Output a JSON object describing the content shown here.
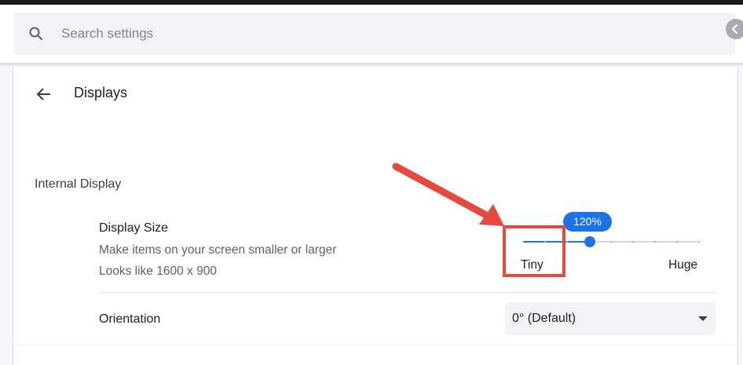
{
  "search": {
    "placeholder": "Search settings"
  },
  "page": {
    "title": "Displays"
  },
  "section": {
    "title": "Internal Display"
  },
  "display_size": {
    "label": "Display Size",
    "description": "Make items on your screen smaller or larger",
    "resolution": "Looks like 1600 x 900",
    "value_label": "120%",
    "min_label": "Tiny",
    "max_label": "Huge",
    "position_fraction": 0.38,
    "tick_count": 9
  },
  "orientation": {
    "label": "Orientation",
    "value": "0° (Default)"
  },
  "colors": {
    "accent": "#1a73e8",
    "annotation": "#e8493d"
  },
  "icons": {
    "search": "search-icon",
    "back": "arrow-back-icon",
    "collapse": "chevron-left-icon",
    "dropdown": "caret-down-icon"
  }
}
